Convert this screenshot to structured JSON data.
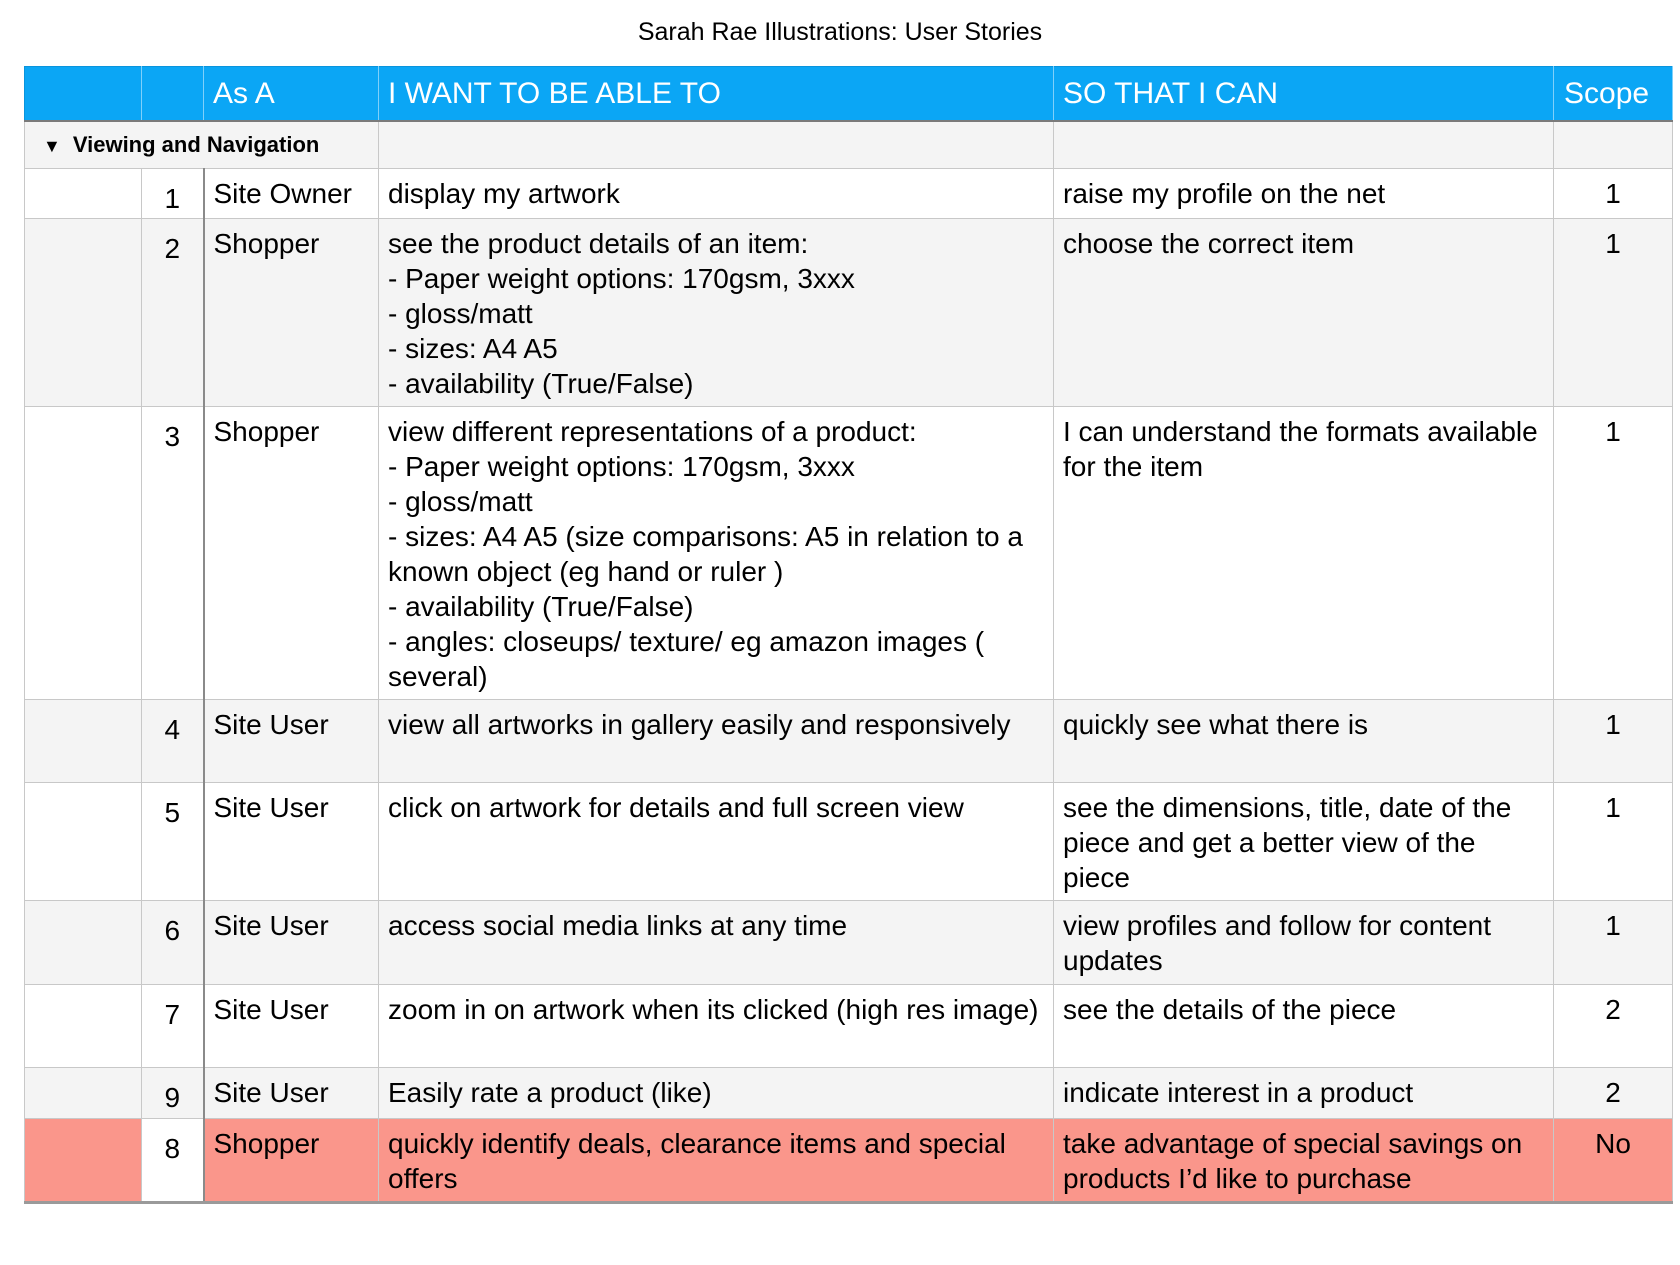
{
  "title": "Sarah Rae Illustrations: User Stories",
  "columns": {
    "as_a": "As A",
    "want": "I WANT TO BE ABLE TO",
    "so_that": "SO THAT I CAN",
    "scope": "Scope"
  },
  "group": {
    "toggle_icon": "▼",
    "label": "Viewing and Navigation"
  },
  "rows": [
    {
      "num": "1",
      "as_a": "Site Owner",
      "want": "display my artwork",
      "so_that": "raise my profile on the net",
      "scope": "1"
    },
    {
      "num": "2",
      "as_a": "Shopper",
      "want": "see the product details of an item:\n- Paper weight options: 170gsm, 3xxx\n- gloss/matt\n- sizes: A4 A5\n- availability (True/False)",
      "so_that": "choose the correct item",
      "scope": "1"
    },
    {
      "num": "3",
      "as_a": "Shopper",
      "want": "view different representations of a product:\n- Paper weight options: 170gsm, 3xxx\n- gloss/matt\n- sizes: A4 A5 (size comparisons: A5 in relation to a known object (eg hand or ruler )\n- availability (True/False)\n- angles: closeups/ texture/  eg amazon images ( several)",
      "so_that": "I can understand the formats available for the item",
      "scope": "1"
    },
    {
      "num": "4",
      "as_a": "Site User",
      "want": "view all artworks in gallery easily and responsively",
      "so_that": "quickly see what there is",
      "scope": "1"
    },
    {
      "num": "5",
      "as_a": "Site User",
      "want": "click on artwork for details and full screen view",
      "so_that": "see the dimensions, title, date of the piece and get a better view of the piece",
      "scope": "1"
    },
    {
      "num": "6",
      "as_a": "Site User",
      "want": "access social media links at any time",
      "so_that": "view profiles and follow for content updates",
      "scope": "1"
    },
    {
      "num": "7",
      "as_a": "Site User",
      "want": "zoom in on artwork when its clicked (high res image)",
      "so_that": "see the details of the piece",
      "scope": "2"
    },
    {
      "num": "9",
      "as_a": "Site User",
      "want": "Easily rate a product (like)",
      "so_that": "indicate interest in a product",
      "scope": "2"
    },
    {
      "num": "8",
      "as_a": "Shopper",
      "want": "quickly identify deals, clearance items and special offers",
      "so_that": "take advantage of special savings on products I’d like to purchase",
      "scope": "No"
    }
  ],
  "colors": {
    "header_bg": "#0ba6f5",
    "highlight_row_bg": "#fa968b",
    "alt_row_bg": "#f4f4f4"
  }
}
